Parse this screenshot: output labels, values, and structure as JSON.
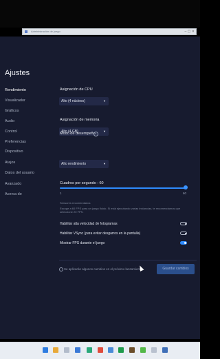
{
  "window": {
    "title": "Administración de juego"
  },
  "settings": {
    "title": "Ajustes",
    "sidebar": [
      {
        "label": "Rendimiento",
        "active": true
      },
      {
        "label": "Visualizador"
      },
      {
        "label": "Gráficos"
      },
      {
        "label": "Audio"
      },
      {
        "label": "Control"
      },
      {
        "label": "Preferencias"
      },
      {
        "label": "Dispositivo"
      },
      {
        "label": "Atajos"
      },
      {
        "label": "Datos del usuario"
      },
      {
        "label": "Avanzado"
      },
      {
        "label": "Acerca de"
      }
    ],
    "cpu": {
      "label": "Asignación de CPU",
      "value": "Alto (4 núcleos)"
    },
    "memory": {
      "label": "Asignación de memoria",
      "value": "Alto (4 GB)"
    },
    "performance_mode": {
      "label": "Modo de desempeño",
      "value": "Alto rendimiento"
    },
    "fps": {
      "label": "Cuadros por segundo : 60",
      "min_label": "1",
      "max_label": "60",
      "fraction": 1.0,
      "recommended_text": "Sensores recomendados",
      "info_text": "Escoge a 60 FPS para un juego fluido. Si está ejecutando varias instancias, te recomendamos que seleccione 20 FPS."
    },
    "toggles": [
      {
        "label": "Habilitar alta velocidad de fotogramas",
        "on": false
      },
      {
        "label": "Habilitar VSync (para evitar desgarros en la pantalla)",
        "on": false
      },
      {
        "label": "Mostrar FPS durante el juego",
        "on": true
      }
    ],
    "notice": "Se aplicarán algunos cambios en el próximo lanzamiento",
    "save_label": "Guardar cambios"
  },
  "colors": {
    "background": "#171b2f",
    "accent": "#2f8cff",
    "button": "#2b4f8c"
  },
  "taskbar_icons": [
    "windows-icon",
    "search-icon",
    "file-explorer-icon",
    "store-icon",
    "edge-icon",
    "chrome-icon",
    "mail-icon",
    "excel-icon",
    "game-icon",
    "bluestacks-icon",
    "app-icon",
    "image-icon"
  ]
}
